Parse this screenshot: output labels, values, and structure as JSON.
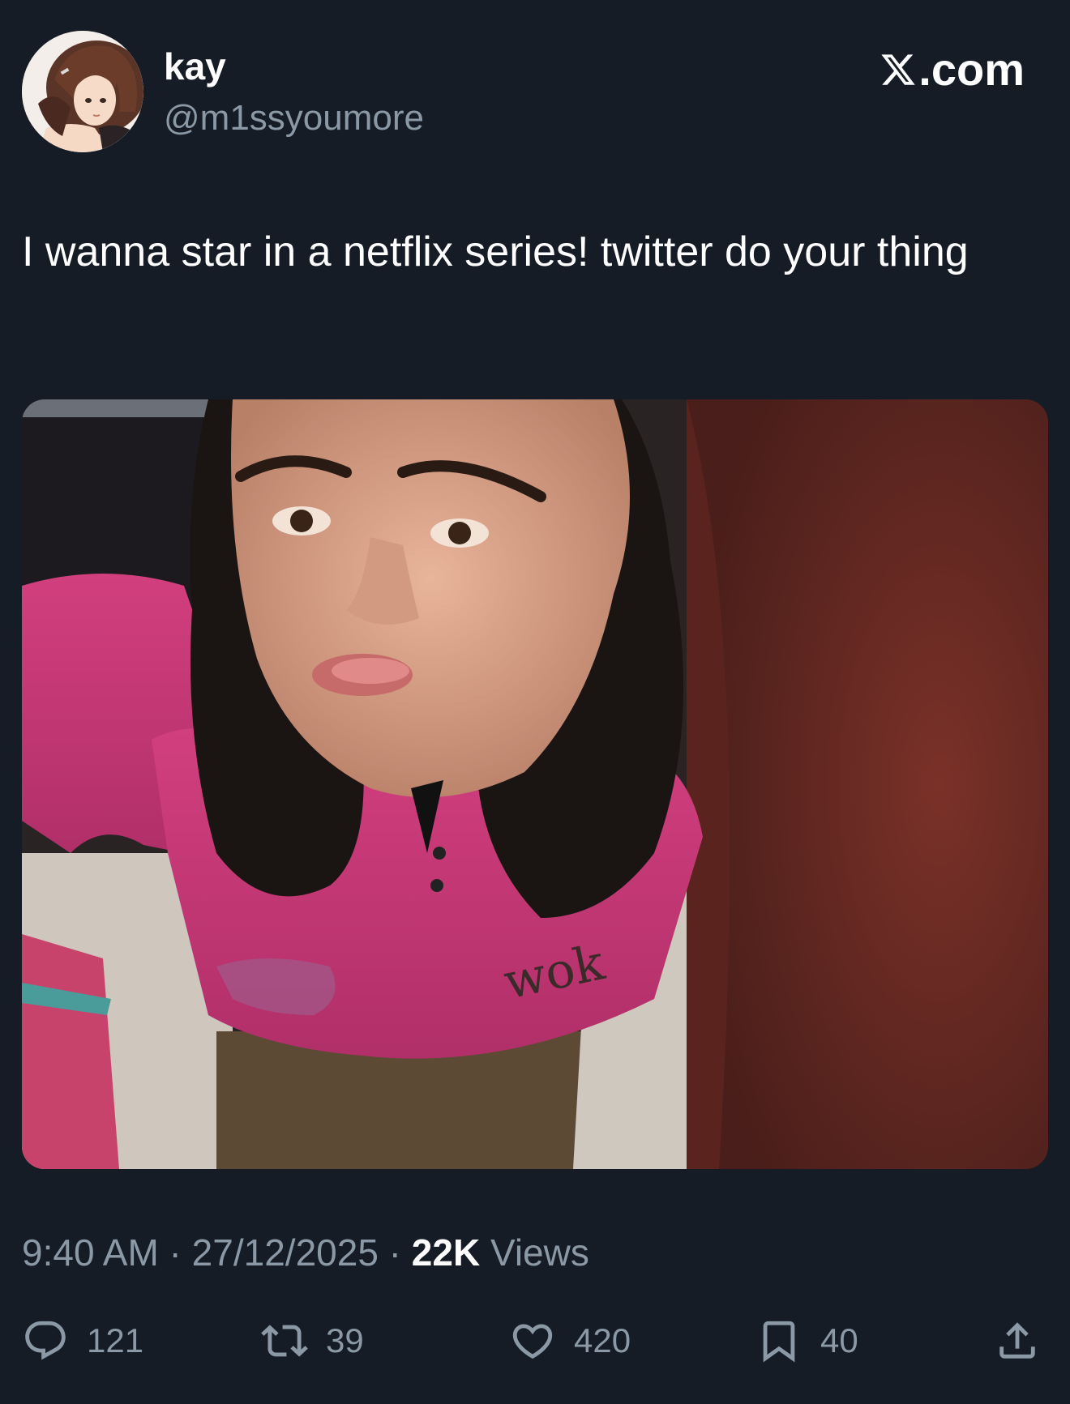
{
  "author": {
    "display_name": "kay",
    "handle": "@m1ssyoumore",
    "avatar_icon": "anime-avatar-image"
  },
  "brand": {
    "logo_icon": "x-logo-icon",
    "domain_suffix": ".com"
  },
  "tweet": {
    "text": "I wanna star in a netflix series! twitter do your thing",
    "media_icon": "selfie-photo-image"
  },
  "meta": {
    "time": "9:40 AM",
    "separator": " · ",
    "date": "27/12/2025",
    "views_count": "22K",
    "views_label": " Views"
  },
  "actions": {
    "reply": {
      "icon": "reply-icon",
      "count": "121"
    },
    "retweet": {
      "icon": "retweet-icon",
      "count": "39"
    },
    "like": {
      "icon": "heart-icon",
      "count": "420"
    },
    "bookmark": {
      "icon": "bookmark-icon",
      "count": "40"
    },
    "share": {
      "icon": "share-icon"
    }
  },
  "colors": {
    "background": "#151c26",
    "text_primary": "#ffffff",
    "text_secondary": "#8b98a5"
  }
}
